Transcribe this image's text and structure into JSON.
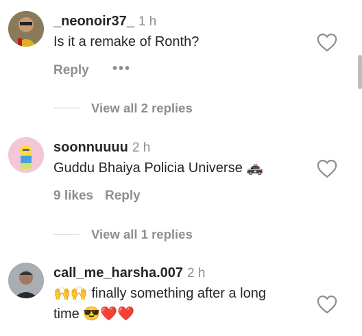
{
  "comments": [
    {
      "username": "_neonoir37_",
      "time": "1 h",
      "text": "Is it a remake of Ronth?",
      "reply_label": "Reply",
      "more_label": "•••",
      "view_replies": "View all 2 replies"
    },
    {
      "username": "soonnuuuu",
      "time": "2 h",
      "text": "Guddu Bhaiya Policia Universe 🚓",
      "likes": "9 likes",
      "reply_label": "Reply",
      "view_replies": "View all 1 replies"
    },
    {
      "username": "call_me_harsha.007",
      "time": "2 h",
      "text_line1": "🙌🙌 finally something after a long",
      "text_line2": "time 😎❤️❤️"
    }
  ],
  "icons": {
    "heart": "heart-outline-icon",
    "avatar": "avatar"
  },
  "colors": {
    "primary_text": "#262626",
    "secondary_text": "#8e8e8e"
  }
}
